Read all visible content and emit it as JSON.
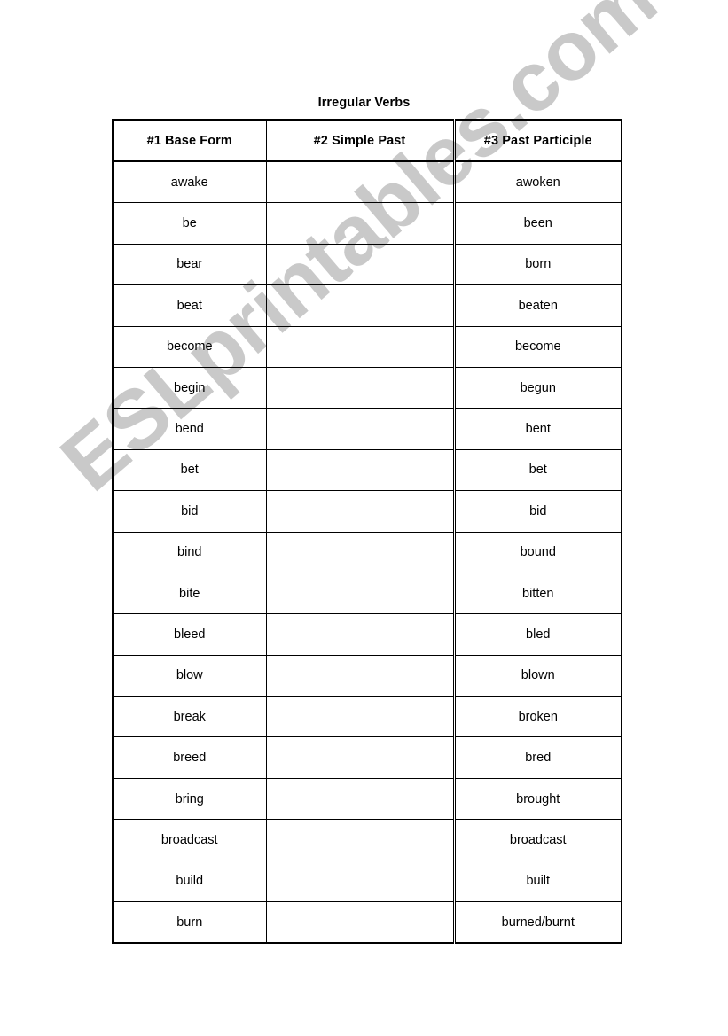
{
  "document": {
    "title": "Irregular Verbs"
  },
  "watermark": {
    "text": "ESLprintables.com",
    "color": "#c9c9c9",
    "rotation_deg": -40.5
  },
  "table": {
    "name": "irregular-verbs-table",
    "headers": [
      "#1 Base Form",
      "#2 Simple Past",
      "#3 Past Participle"
    ],
    "rows": [
      {
        "base": "awake",
        "past": "",
        "participle": "awoken"
      },
      {
        "base": "be",
        "past": "",
        "participle": "been"
      },
      {
        "base": "bear",
        "past": "",
        "participle": "born"
      },
      {
        "base": "beat",
        "past": "",
        "participle": "beaten"
      },
      {
        "base": "become",
        "past": "",
        "participle": "become"
      },
      {
        "base": "begin",
        "past": "",
        "participle": "begun"
      },
      {
        "base": "bend",
        "past": "",
        "participle": "bent"
      },
      {
        "base": "bet",
        "past": "",
        "participle": "bet"
      },
      {
        "base": "bid",
        "past": "",
        "participle": "bid"
      },
      {
        "base": "bind",
        "past": "",
        "participle": "bound"
      },
      {
        "base": "bite",
        "past": "",
        "participle": "bitten"
      },
      {
        "base": "bleed",
        "past": "",
        "participle": "bled"
      },
      {
        "base": "blow",
        "past": "",
        "participle": "blown"
      },
      {
        "base": "break",
        "past": "",
        "participle": "broken"
      },
      {
        "base": "breed",
        "past": "",
        "participle": "bred"
      },
      {
        "base": "bring",
        "past": "",
        "participle": "brought"
      },
      {
        "base": "broadcast",
        "past": "",
        "participle": "broadcast"
      },
      {
        "base": "build",
        "past": "",
        "participle": "built"
      },
      {
        "base": "burn",
        "past": "",
        "participle": "burned/burnt"
      }
    ]
  }
}
